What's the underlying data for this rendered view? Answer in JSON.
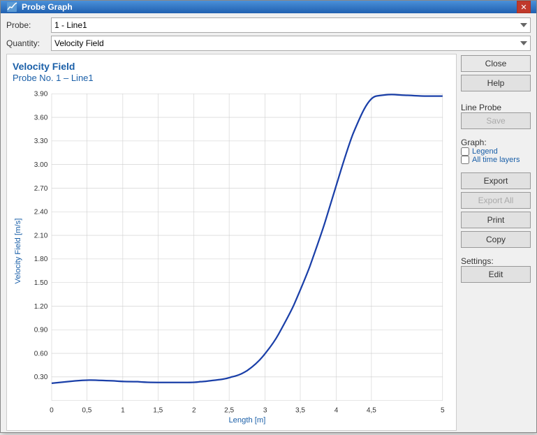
{
  "window": {
    "title": "Probe Graph",
    "close_label": "✕"
  },
  "form": {
    "probe_label": "Probe:",
    "probe_value": "1 - Line1",
    "quantity_label": "Quantity:",
    "quantity_value": "Velocity Field"
  },
  "chart": {
    "title": "Velocity Field",
    "subtitle": "Probe No. 1 – Line1",
    "x_axis_label": "Length [m]",
    "y_axis_label": "Velocity Field [m/s]",
    "x_ticks": [
      "0",
      "0,5",
      "1",
      "1,5",
      "2",
      "2,5",
      "3",
      "3,5",
      "4",
      "4,5",
      "5"
    ],
    "y_ticks": [
      "0.30",
      "0.60",
      "0.90",
      "1.20",
      "1.50",
      "1.80",
      "2.10",
      "2.40",
      "2.70",
      "3.00",
      "3.30",
      "3.60",
      "3.90"
    ]
  },
  "right_panel": {
    "close_label": "Close",
    "help_label": "Help",
    "line_probe_label": "Line Probe",
    "save_label": "Save",
    "graph_label": "Graph:",
    "legend_label": "Legend",
    "all_time_layers_label": "All time layers",
    "export_label": "Export",
    "export_all_label": "Export All",
    "print_label": "Print",
    "copy_label": "Copy",
    "settings_label": "Settings:",
    "edit_label": "Edit"
  }
}
